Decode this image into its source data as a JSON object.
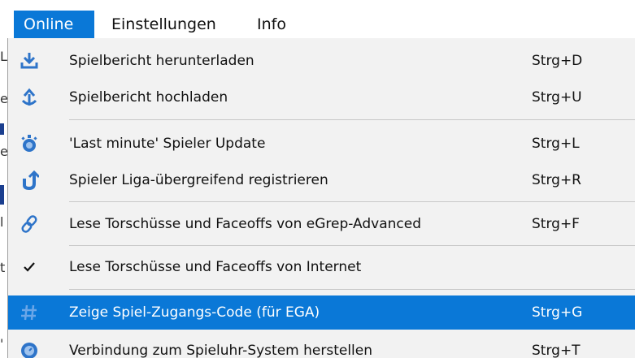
{
  "menubar": {
    "items": [
      {
        "label": "Online",
        "active": true
      },
      {
        "label": "Einstellungen",
        "active": false
      },
      {
        "label": "Info",
        "active": false
      }
    ]
  },
  "background_fragments": [
    "L",
    "e",
    "e",
    "l",
    "t",
    "'"
  ],
  "menu": {
    "items": [
      {
        "label": "Spielbericht herunterladen",
        "shortcut": "Strg+D",
        "icon": "download-icon"
      },
      {
        "label": "Spielbericht hochladen",
        "shortcut": "Strg+U",
        "icon": "upload-icon"
      },
      {
        "label": "'Last minute' Spieler Update",
        "shortcut": "Strg+L",
        "icon": "stopwatch-icon"
      },
      {
        "label": "Spieler Liga-übergreifend registrieren",
        "shortcut": "Strg+R",
        "icon": "undo-arrow-icon"
      },
      {
        "label": "Lese Torschüsse und Faceoffs von eGrep-Advanced",
        "shortcut": "Strg+F",
        "icon": "link-icon"
      },
      {
        "label": "Lese Torschüsse und Faceoffs von Internet",
        "shortcut": "",
        "icon": "checkmark-icon",
        "checked": true
      },
      {
        "label": "Zeige Spiel-Zugangs-Code (für EGA)",
        "shortcut": "Strg+G",
        "icon": "hash-icon",
        "highlighted": true
      },
      {
        "label": "Verbindung zum Spieluhr-System herstellen",
        "shortcut": "Strg+T",
        "icon": "clock-icon"
      }
    ]
  },
  "colors": {
    "highlight": "#0a78d7",
    "menu_background": "#f2f2f2",
    "icon_blue": "#2e74c9"
  }
}
